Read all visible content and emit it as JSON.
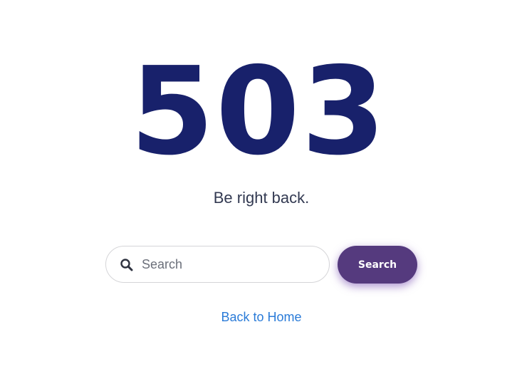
{
  "error": {
    "code": "503",
    "message": "Be right back."
  },
  "search": {
    "placeholder": "Search",
    "icon": "search-icon",
    "button_label": "Search"
  },
  "links": {
    "home_label": "Back to Home"
  },
  "colors": {
    "code": "#18216b",
    "subtitle": "#333a52",
    "button": "#553a7e",
    "link": "#2a7bd8"
  }
}
